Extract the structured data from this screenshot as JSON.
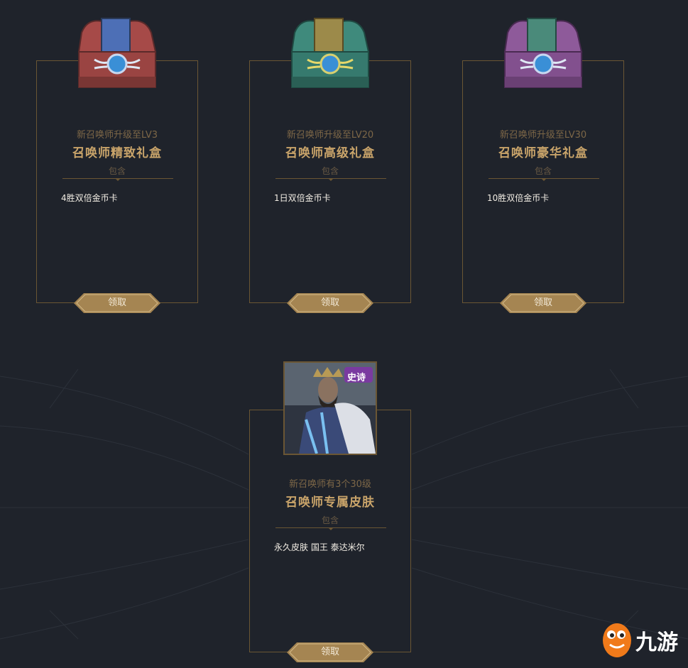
{
  "cards": [
    {
      "requirement": "新召唤师升级至LV3",
      "title": "召唤师精致礼盒",
      "contains_label": "包含",
      "reward": "4胜双倍金币卡",
      "button_label": "领取",
      "chest_color": "#a64a48",
      "chest_accent": "#4d6fb6"
    },
    {
      "requirement": "新召唤师升级至LV20",
      "title": "召唤师高级礼盒",
      "contains_label": "包含",
      "reward": "1日双倍金币卡",
      "button_label": "领取",
      "chest_color": "#3f8a7c",
      "chest_accent": "#9c8a4a"
    },
    {
      "requirement": "新召唤师升级至LV30",
      "title": "召唤师豪华礼盒",
      "contains_label": "包含",
      "reward": "10胜双倍金币卡",
      "button_label": "领取",
      "chest_color": "#8e5a9a",
      "chest_accent": "#4a8a7a"
    },
    {
      "requirement": "新召唤师有3个30级",
      "title": "召唤师专属皮肤",
      "contains_label": "包含",
      "reward": "永久皮肤 国王 泰达米尔",
      "button_label": "领取",
      "badge": "史诗"
    }
  ],
  "logo": {
    "text": "九游"
  },
  "colors": {
    "background": "#1f232b",
    "border_gold": "#6b5634",
    "title_gold": "#c9a46a",
    "button_gold": "#a58552"
  },
  "icons": [
    "chest-icon",
    "skin-portrait",
    "jiuyou-logo"
  ]
}
